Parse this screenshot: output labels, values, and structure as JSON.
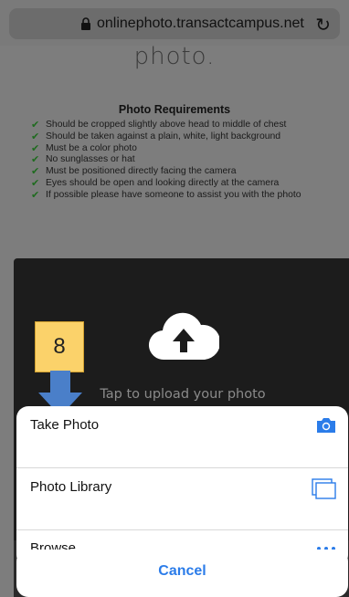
{
  "browser": {
    "url": "onlinephoto.transactcampus.net"
  },
  "page": {
    "heading_fragment": "photo.",
    "requirements_title": "Photo Requirements",
    "requirements": [
      "Should be cropped slightly above head to middle of chest",
      "Should be taken against a plain, white, light background",
      "Must be a color photo",
      "No sunglasses or hat",
      "Must be positioned directly facing the camera",
      "Eyes should be open and looking directly at the camera",
      "If possible please have someone to assist you with the photo"
    ],
    "check_glyph": "✔",
    "upload_label": "Tap to upload your photo"
  },
  "annotation": {
    "step_number": "8"
  },
  "action_sheet": {
    "items": [
      {
        "label": "Take Photo",
        "icon": "camera-icon"
      },
      {
        "label": "Photo Library",
        "icon": "photo-library-icon"
      },
      {
        "label": "Browse",
        "icon": "more-icon"
      }
    ],
    "cancel_label": "Cancel"
  },
  "colors": {
    "accent": "#2b7ce9",
    "step_badge": "#fbd26a",
    "step_arrow": "#4a7fc9",
    "check": "#1f6b1f"
  }
}
